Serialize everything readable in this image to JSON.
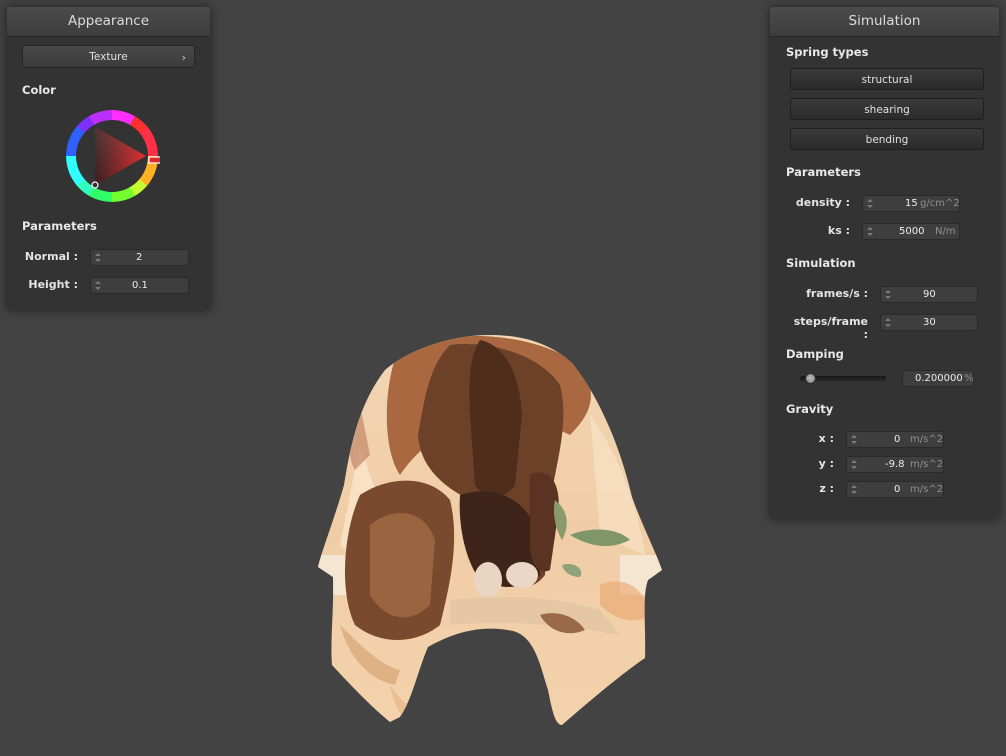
{
  "appearance": {
    "title": "Appearance",
    "texture_label": "Texture",
    "color_label": "Color",
    "parameters_label": "Parameters",
    "normal_label": "Normal :",
    "normal_value": "2",
    "height_label": "Height :",
    "height_value": "0.1"
  },
  "simulation": {
    "title": "Simulation",
    "spring_types_label": "Spring types",
    "spring_buttons": [
      "structural",
      "shearing",
      "bending"
    ],
    "parameters_label": "Parameters",
    "density_label": "density :",
    "density_value": "15",
    "density_unit": "g/cm^2",
    "ks_label": "ks :",
    "ks_value": "5000",
    "ks_unit": "N/m",
    "simulation_label": "Simulation",
    "fps_label": "frames/s :",
    "fps_value": "90",
    "steps_label": "steps/frame :",
    "steps_value": "30",
    "damping_label": "Damping",
    "damping_value": "0.200000",
    "damping_unit": "%",
    "damping_fraction": 0.2,
    "gravity_label": "Gravity",
    "gx_label": "x :",
    "gx_value": "0",
    "gx_unit": "m/s^2",
    "gy_label": "y :",
    "gy_value": "-9.8",
    "gy_unit": "m/s^2",
    "gz_label": "z :",
    "gz_value": "0",
    "gz_unit": "m/s^2"
  },
  "colors": {
    "background": "#434343",
    "panel": "#333333",
    "selected_color": "#e0262b"
  }
}
